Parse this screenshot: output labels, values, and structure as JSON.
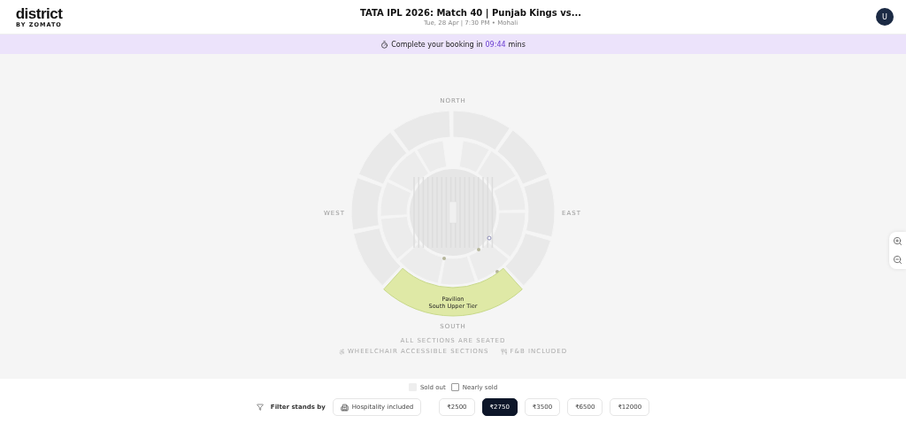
{
  "header": {
    "logo": "district",
    "logo_sub": "BY ZOMATO",
    "title": "TATA IPL 2026: Match 40 | Punjab Kings vs...",
    "subtitle": "Tue, 28 Apr | 7:30 PM • Mohali",
    "avatar": "U"
  },
  "timer": {
    "text": "Complete your booking in",
    "time": "09:44",
    "unit": "mins"
  },
  "map": {
    "directions": {
      "north": "NORTH",
      "east": "EAST",
      "south": "SOUTH",
      "west": "WEST"
    },
    "highlighted_stand": {
      "name": "Pavilion",
      "tier": "South Upper Tier",
      "selected": true
    },
    "notes": [
      "ALL SECTIONS ARE SEATED"
    ],
    "legend_items": [
      "WHEELCHAIR ACCESSIBLE SECTIONS",
      "F&B INCLUDED"
    ]
  },
  "availability": [
    {
      "label": "Sold out",
      "kind": "filled"
    },
    {
      "label": "Nearly sold",
      "kind": "outline"
    }
  ],
  "filter": {
    "label": "Filter stands by",
    "hospitality": {
      "label": "Hospitality included",
      "selected": false
    },
    "prices": [
      {
        "label": "₹2500",
        "selected": false
      },
      {
        "label": "₹2750",
        "selected": true
      },
      {
        "label": "₹3500",
        "selected": false
      },
      {
        "label": "₹6500",
        "selected": false
      },
      {
        "label": "₹12000",
        "selected": false
      }
    ]
  }
}
